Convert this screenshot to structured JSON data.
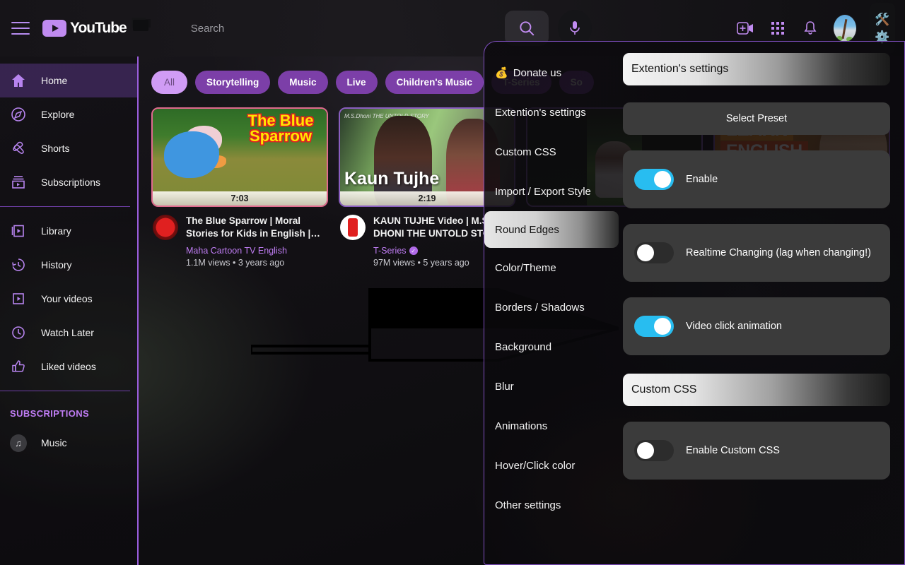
{
  "header": {
    "menu_icon": "hamburger-icon",
    "logo_text": "YouTube",
    "search_placeholder": "Search",
    "search_value": "",
    "search_icon": "search-icon",
    "mic_icon": "microphone-icon",
    "create_icon": "create-video-icon",
    "apps_icon": "apps-grid-icon",
    "notifications_icon": "bell-icon",
    "avatar_icon": "user-avatar",
    "extension_tools_icon": "tools-icon",
    "extension_gear_icon": "gear-icon"
  },
  "sidebar": {
    "items": [
      {
        "label": "Home",
        "icon": "home-icon",
        "active": true
      },
      {
        "label": "Explore",
        "icon": "compass-icon",
        "active": false
      },
      {
        "label": "Shorts",
        "icon": "shorts-icon",
        "active": false
      },
      {
        "label": "Subscriptions",
        "icon": "subscriptions-icon",
        "active": false
      }
    ],
    "items2": [
      {
        "label": "Library",
        "icon": "library-icon"
      },
      {
        "label": "History",
        "icon": "history-icon"
      },
      {
        "label": "Your videos",
        "icon": "your-videos-icon"
      },
      {
        "label": "Watch Later",
        "icon": "clock-icon"
      },
      {
        "label": "Liked videos",
        "icon": "thumbs-up-icon"
      }
    ],
    "section_title": "SUBSCRIPTIONS",
    "subscriptions": [
      {
        "label": "Music",
        "icon": "music-note-icon"
      }
    ]
  },
  "chips": [
    {
      "label": "All",
      "selected": true
    },
    {
      "label": "Storytelling",
      "selected": false
    },
    {
      "label": "Music",
      "selected": false
    },
    {
      "label": "Live",
      "selected": false
    },
    {
      "label": "Children's Music",
      "selected": false
    },
    {
      "label": "T-Series",
      "selected": false
    },
    {
      "label": "So",
      "selected": false
    }
  ],
  "videos": [
    {
      "title": "The Blue Sparrow | Moral Stories for Kids in English | English Cartoo...",
      "channel": "Maha Cartoon TV English",
      "verified": false,
      "stats": "1.1M views • 3 years ago",
      "duration": "7:03",
      "thumb_text": "The Blue Sparrow"
    },
    {
      "title": "KAUN TUJHE Video | M.S. DHONI THE UNTOLD STORY |Amaal  Ma...",
      "channel": "T-Series",
      "verified": true,
      "stats": "97M views • 5 years ago",
      "duration": "2:19",
      "thumb_text": "Kaun Tujhe",
      "thumb_logo": "M.S.Dhoni THE UNTOLD STORY"
    },
    {
      "title": "",
      "channel": "",
      "verified": false,
      "stats": "",
      "duration": "",
      "thumb_text": ""
    },
    {
      "title": "",
      "channel": "",
      "verified": false,
      "stats": "",
      "duration": "",
      "thumb_text": "LEARN ENGLISH with Harry P..."
    }
  ],
  "extension": {
    "nav": [
      {
        "label": "Donate us",
        "icon": "money-bag-icon",
        "selected": false
      },
      {
        "label": "Extention's settings",
        "icon": "",
        "selected": false
      },
      {
        "label": "Custom CSS",
        "icon": "",
        "selected": false
      },
      {
        "label": "Import / Export Style",
        "icon": "",
        "selected": false
      },
      {
        "label": "Round Edges",
        "icon": "",
        "selected": true
      },
      {
        "label": "Color/Theme",
        "icon": "",
        "selected": false
      },
      {
        "label": "Borders / Shadows",
        "icon": "",
        "selected": false
      },
      {
        "label": "Background",
        "icon": "",
        "selected": false
      },
      {
        "label": "Blur",
        "icon": "",
        "selected": false
      },
      {
        "label": "Animations",
        "icon": "",
        "selected": false
      },
      {
        "label": "Hover/Click color",
        "icon": "",
        "selected": false
      },
      {
        "label": "Other settings",
        "icon": "",
        "selected": false
      }
    ],
    "title_bar": "Extention's settings",
    "preset_button": "Select Preset",
    "toggles": [
      {
        "label": "Enable",
        "state": "on"
      },
      {
        "label": "Realtime Changing (lag when changing!)",
        "state": "off"
      },
      {
        "label": "Video click animation",
        "state": "on"
      }
    ],
    "custom_css_bar": "Custom CSS",
    "bottom_toggle": {
      "label": "Enable Custom CSS",
      "state": "off"
    }
  },
  "colors": {
    "accent_purple": "#9b5ede",
    "toggle_on": "#28bdf0",
    "chip_purple": "#7c3fa8",
    "chip_selected": "#d09cf5",
    "channel_text": "#c07df5"
  }
}
